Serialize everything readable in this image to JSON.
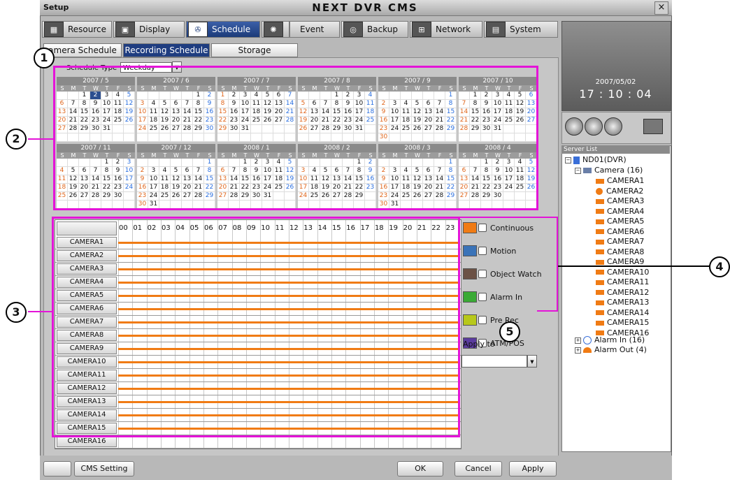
{
  "window": {
    "app_label": "Setup",
    "title": "NEXT DVR CMS",
    "close_label": "×"
  },
  "tabs": [
    {
      "label": "Resource",
      "icon": "grid-icon",
      "glyph": "▦"
    },
    {
      "label": "Display",
      "icon": "monitor-icon",
      "glyph": "▣"
    },
    {
      "label": "Schedule",
      "icon": "reel-icon",
      "glyph": "✇"
    },
    {
      "label": "",
      "icon": "alarm-light-icon",
      "glyph": "✺"
    },
    {
      "label": "Event",
      "icon": "event-icon",
      "glyph": ""
    },
    {
      "label": "Backup",
      "icon": "disc-icon",
      "glyph": "◎"
    },
    {
      "label": "Network",
      "icon": "network-icon",
      "glyph": "⊞"
    },
    {
      "label": "System",
      "icon": "system-icon",
      "glyph": "▤"
    }
  ],
  "subtabs": [
    "amera Schedule",
    "Recording Schedule",
    "Storage"
  ],
  "schedule_type": {
    "label": "Schedule Type",
    "value": "Weekday",
    "arrow": "▼"
  },
  "callouts": [
    "1",
    "2",
    "3",
    "4",
    "5"
  ],
  "weekday_header": [
    "S",
    "M",
    "T",
    "W",
    "T",
    "F",
    "S"
  ],
  "calendars": [
    {
      "title": "2007 / 5",
      "start": 2,
      "days": 31,
      "selected": 2
    },
    {
      "title": "2007 / 6",
      "start": 5,
      "days": 30
    },
    {
      "title": "2007 / 7",
      "start": 0,
      "days": 31
    },
    {
      "title": "2007 / 8",
      "start": 3,
      "days": 31
    },
    {
      "title": "2007 / 9",
      "start": 6,
      "days": 30
    },
    {
      "title": "2007 / 10",
      "start": 1,
      "days": 31
    },
    {
      "title": "2007 / 11",
      "start": 4,
      "days": 30
    },
    {
      "title": "2007 / 12",
      "start": 6,
      "days": 31
    },
    {
      "title": "2008 / 1",
      "start": 2,
      "days": 31
    },
    {
      "title": "2008 / 2",
      "start": 5,
      "days": 29
    },
    {
      "title": "2008 / 3",
      "start": 6,
      "days": 31
    },
    {
      "title": "2008 / 4",
      "start": 2,
      "days": 30
    }
  ],
  "hours": [
    "00",
    "01",
    "02",
    "03",
    "04",
    "05",
    "06",
    "07",
    "08",
    "09",
    "10",
    "11",
    "12",
    "13",
    "14",
    "15",
    "16",
    "17",
    "18",
    "19",
    "20",
    "21",
    "22",
    "23"
  ],
  "cameras": [
    "CAMERA1",
    "CAMERA2",
    "CAMERA3",
    "CAMERA4",
    "CAMERA5",
    "CAMERA6",
    "CAMERA7",
    "CAMERA8",
    "CAMERA9",
    "CAMERA10",
    "CAMERA11",
    "CAMERA12",
    "CAMERA13",
    "CAMERA14",
    "CAMERA15",
    "CAMERA16"
  ],
  "legend": [
    {
      "label": "Continuous",
      "color": "#f07b14"
    },
    {
      "label": "Motion",
      "color": "#3a73b8"
    },
    {
      "label": "Object Watch",
      "color": "#6b5145"
    },
    {
      "label": "Alarm In",
      "color": "#3aaa35"
    },
    {
      "label": "Pre Rec",
      "color": "#b7c81a"
    },
    {
      "label": "ATM/POS",
      "color": "#5b3c9e"
    }
  ],
  "apply_to": {
    "label": "Apply to",
    "value": "",
    "arrow": "▼"
  },
  "preview": {
    "date": "2007/05/02",
    "time": "17 : 10 : 04"
  },
  "server_list": {
    "header": "Server List",
    "server": "ND01(DVR)",
    "camera_group": "Camera (16)",
    "cameras": [
      "CAMERA1",
      "CAMERA2",
      "CAMERA3",
      "CAMERA4",
      "CAMERA5",
      "CAMERA6",
      "CAMERA7",
      "CAMERA8",
      "CAMERA9",
      "CAMERA10",
      "CAMERA11",
      "CAMERA12",
      "CAMERA13",
      "CAMERA14",
      "CAMERA15",
      "CAMERA16"
    ],
    "alarm_in": "Alarm In (16)",
    "alarm_out": "Alarm Out (4)"
  },
  "bottom": {
    "cms_setting": "CMS Setting",
    "ok": "OK",
    "cancel": "Cancel",
    "apply": "Apply",
    "keyboard_icon": "keyboard-icon"
  }
}
